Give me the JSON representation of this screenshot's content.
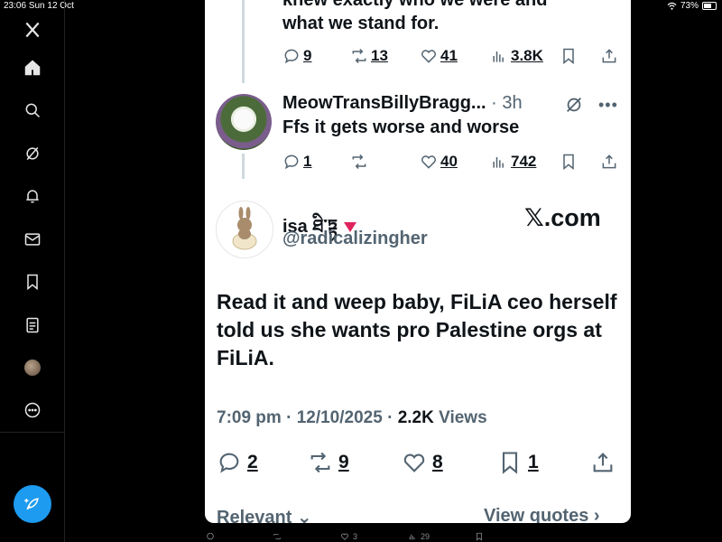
{
  "status_bar": {
    "time": "23:06",
    "date": "Sun 12 Oct",
    "battery": "73%"
  },
  "sidebar": {
    "items": [
      "x-logo",
      "home-icon",
      "search-icon",
      "grok-icon",
      "notifications-icon",
      "messages-icon",
      "bookmarks-icon",
      "lists-icon",
      "profile-avatar",
      "more-icon"
    ]
  },
  "thread_top": {
    "text_lines": [
      "knew exactly who we were and",
      "what we stand for."
    ],
    "replies": "9",
    "reposts": "13",
    "likes": "41",
    "views": "3.8K"
  },
  "reply": {
    "name": "MeowTransBillyBragg...",
    "time": " · 3h",
    "text": "Ffs it gets worse and worse",
    "replies": "1",
    "reposts": "",
    "likes": "40",
    "views": "742"
  },
  "main_post": {
    "display_name": "isa ཐི་ཏྟ ",
    "handle": "@radicalizingher",
    "brand": "𝕏.com",
    "text": "Read it and weep baby, FiLiA ceo herself told us she wants pro Palestine orgs at FiLiA.",
    "time": "7:09 pm",
    "date": "12/10/2025",
    "views_count": "2.2K",
    "views_label": "Views",
    "replies": "2",
    "reposts": "9",
    "likes": "8",
    "bookmarks": "1"
  },
  "bottom": {
    "sort_label": "Relevant",
    "quotes_label": "View quotes"
  },
  "peek_row": {
    "likes": "3",
    "views": "29"
  },
  "colors": {
    "accent": "#1d9bf0",
    "muted": "#536471",
    "text": "#0f1419",
    "badge_red": "#e0245e"
  }
}
